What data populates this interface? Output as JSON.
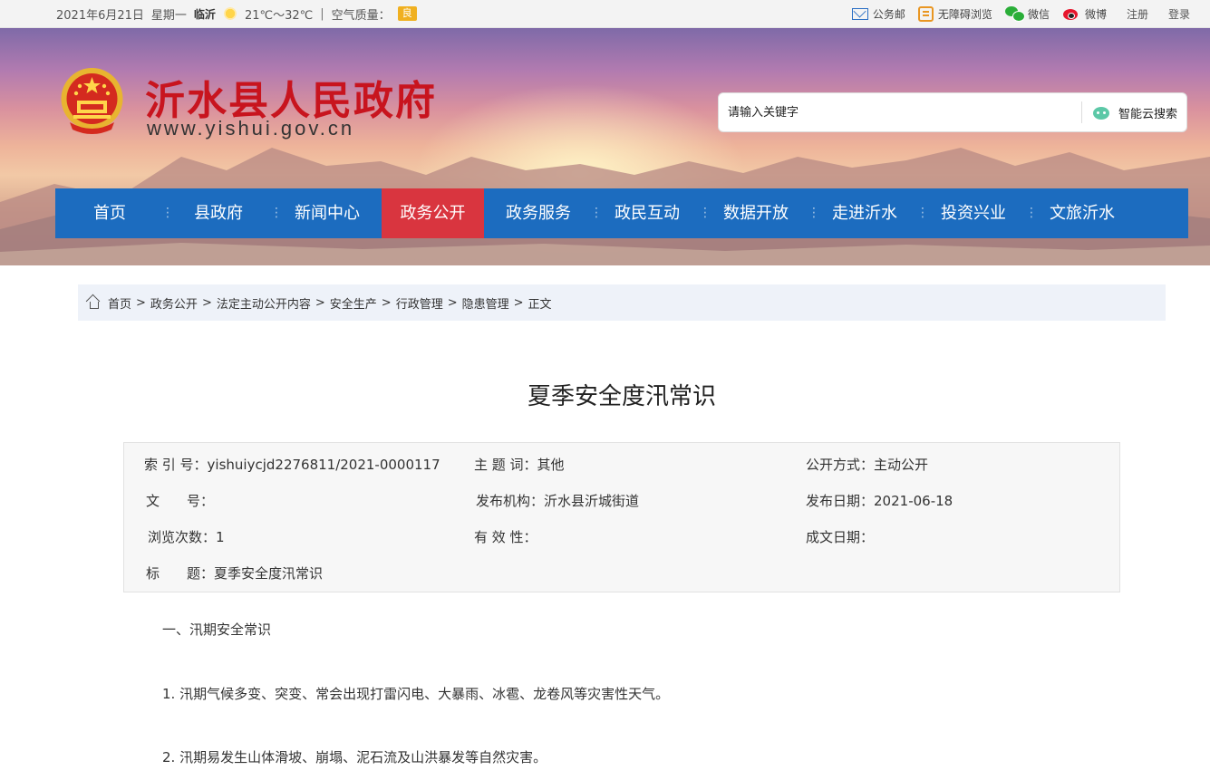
{
  "topbar": {
    "date": "2021年6月21日",
    "weekday": "星期一",
    "city": "临沂",
    "temperature": "21℃～32℃",
    "air_quality_label": "空气质量：",
    "air_quality_value": "良",
    "links": {
      "mail": "公务邮",
      "accessibility": "无障碍浏览",
      "wechat": "微信",
      "weibo": "微博",
      "register": "注册",
      "login": "登录"
    }
  },
  "header": {
    "site_title": "沂水县人民政府",
    "site_url": "www.yishui.gov.cn",
    "search_placeholder": "请输入关键字",
    "search_button": "智能云搜索"
  },
  "nav": {
    "items": [
      "首页",
      "县政府",
      "新闻中心",
      "政务公开",
      "政务服务",
      "政民互动",
      "数据开放",
      "走进沂水",
      "投资兴业",
      "文旅沂水"
    ],
    "active_index": 3
  },
  "breadcrumb": [
    "首页",
    "政务公开",
    "法定主动公开内容",
    "安全生产",
    "行政管理",
    "隐患管理",
    "正文"
  ],
  "breadcrumb_sep": ">",
  "article": {
    "title": "夏季安全度汛常识",
    "meta": {
      "index_no_label": "索 引 号：",
      "index_no": "yishuiycjd2276811/2021-0000117",
      "subject_label": "主 题 词：",
      "subject": "其他",
      "publicity_label": "公开方式：",
      "publicity": "主动公开",
      "doc_no_label": "文　　号：",
      "doc_no": "",
      "publisher_label": "发布机构：",
      "publisher": "沂水县沂城街道",
      "publish_date_label": "发布日期：",
      "publish_date": "2021-06-18",
      "views_label": "浏览次数：",
      "views": "1",
      "validity_label": "有 效 性：",
      "validity": "",
      "created_date_label": "成文日期：",
      "created_date": "",
      "title_label": "标　　题：",
      "title_value": "夏季安全度汛常识"
    },
    "paragraphs": [
      "一、汛期安全常识",
      "1. 汛期气候多变、突变、常会出现打雷闪电、大暴雨、冰雹、龙卷风等灾害性天气。",
      "2. 汛期易发生山体滑坡、崩塌、泥石流及山洪暴发等自然灾害。"
    ]
  }
}
